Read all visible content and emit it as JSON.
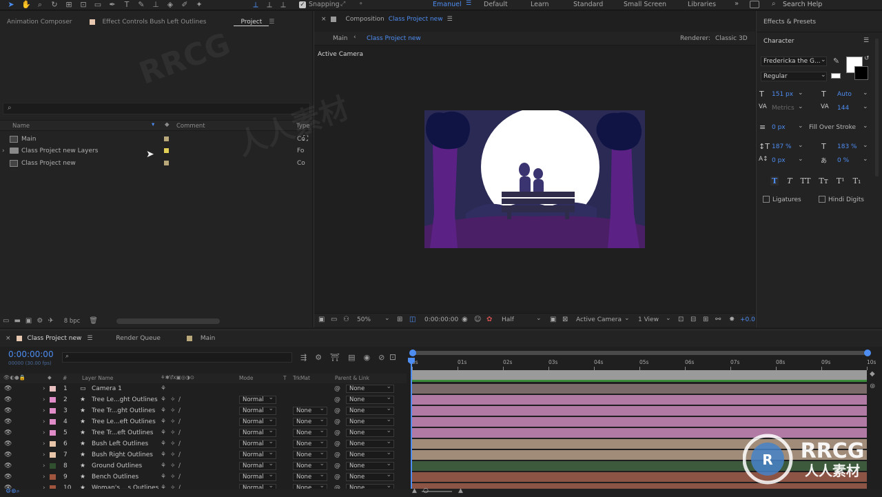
{
  "toolbar": {
    "snapping_label": "Snapping",
    "workspaces": [
      "Emanuel",
      "Default",
      "Learn",
      "Standard",
      "Small Screen",
      "Libraries"
    ],
    "search_placeholder": "Search Help"
  },
  "left_panel": {
    "tabs": [
      "Animation Composer",
      "Effect Controls Bush Left Outlines",
      "Project"
    ],
    "search_placeholder": "",
    "columns": [
      "Name",
      "Comment",
      "Type"
    ],
    "items": [
      {
        "name": "Main",
        "type": "Co",
        "color": "#b9a87a"
      },
      {
        "name": "Class Project new Layers",
        "type": "Fo",
        "color": "#e2cf56"
      },
      {
        "name": "Class Project new",
        "type": "Co",
        "color": "#b9a87a"
      }
    ],
    "bpc": "8 bpc"
  },
  "comp_panel": {
    "title_prefix": "Composition",
    "title_name": "Class Project new",
    "breadcrumb": [
      "Main",
      "Class Project new"
    ],
    "renderer_label": "Renderer:",
    "renderer_value": "Classic 3D",
    "active_camera": "Active Camera",
    "zoom": "50%",
    "timecode": "0:00:00:00",
    "resolution": "Half",
    "view_camera": "Active Camera",
    "view_count": "1 View",
    "exposure": "+0.0"
  },
  "right_panel": {
    "effects_title": "Effects & Presets",
    "character_title": "Character",
    "font_family": "Fredericka the G...",
    "font_style": "Regular",
    "font_size": "151 px",
    "leading": "Auto",
    "kerning": "Metrics",
    "tracking": "144",
    "stroke_width": "0 px",
    "stroke_type": "Fill Over Stroke",
    "vscale": "187 %",
    "hscale": "183 %",
    "baseline": "0 px",
    "tsume": "0 %",
    "ligatures": "Ligatures",
    "hindi_digits": "Hindi Digits"
  },
  "timeline": {
    "tabs": [
      "Class Project new",
      "Render Queue",
      "Main"
    ],
    "timecode": "0:00:00:00",
    "subcode": "00000 (30.00 fps)",
    "columns": [
      "#",
      "Layer Name",
      "Mode",
      "T",
      "TrkMat",
      "Parent & Link"
    ],
    "ruler": [
      "0s",
      "01s",
      "02s",
      "03s",
      "04s",
      "05s",
      "06s",
      "07s",
      "08s",
      "09s",
      "10s"
    ],
    "layers": [
      {
        "num": "1",
        "name": "Camera 1",
        "mode": "",
        "trkmat": "",
        "parent": "None",
        "color": "#e8c0bf",
        "bar": "#7a6a6a",
        "camera": true
      },
      {
        "num": "2",
        "name": "Tree Le...ght Outlines",
        "mode": "Normal",
        "trkmat": "",
        "parent": "None",
        "color": "#e08cc8",
        "bar": "#b07aa4"
      },
      {
        "num": "3",
        "name": "Tree Tr...ght Outlines",
        "mode": "Normal",
        "trkmat": "None",
        "parent": "None",
        "color": "#e08cc8",
        "bar": "#b07aa4"
      },
      {
        "num": "4",
        "name": "Tree Le...eft Outlines",
        "mode": "Normal",
        "trkmat": "None",
        "parent": "None",
        "color": "#e08cc8",
        "bar": "#b07aa4"
      },
      {
        "num": "5",
        "name": "Tree Tr...eft Outlines",
        "mode": "Normal",
        "trkmat": "None",
        "parent": "None",
        "color": "#e08cc8",
        "bar": "#b07aa4"
      },
      {
        "num": "6",
        "name": "Bush Left Outlines",
        "mode": "Normal",
        "trkmat": "None",
        "parent": "None",
        "color": "#e8c4a8",
        "bar": "#a08c78"
      },
      {
        "num": "7",
        "name": "Bush Right Outlines",
        "mode": "Normal",
        "trkmat": "None",
        "parent": "None",
        "color": "#e8c4a8",
        "bar": "#a08c78"
      },
      {
        "num": "8",
        "name": "Ground Outlines",
        "mode": "Normal",
        "trkmat": "None",
        "parent": "None",
        "color": "#2f4f2f",
        "bar": "#3d5a3d"
      },
      {
        "num": "9",
        "name": "Bench Outlines",
        "mode": "Normal",
        "trkmat": "None",
        "parent": "None",
        "color": "#a0553f",
        "bar": "#8c5444"
      },
      {
        "num": "10",
        "name": "Woman's ...s Outlines",
        "mode": "Normal",
        "trkmat": "None",
        "parent": "None",
        "color": "#a0553f",
        "bar": "#8c5444"
      }
    ]
  },
  "watermarks": [
    "RRCG",
    "人人素材"
  ]
}
